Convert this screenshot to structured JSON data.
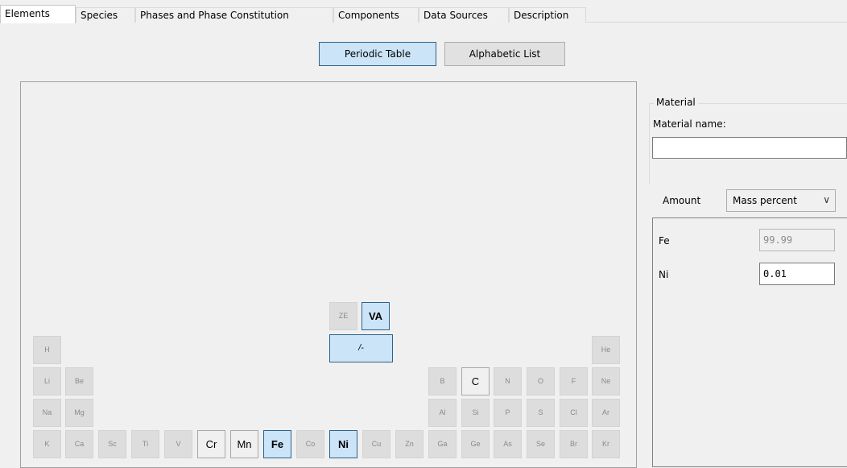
{
  "tabs": [
    {
      "label": "Elements",
      "active": true
    },
    {
      "label": "Species",
      "active": false
    },
    {
      "label": "Phases and Phase Constitution",
      "active": false
    },
    {
      "label": "Components",
      "active": false
    },
    {
      "label": "Data Sources",
      "active": false
    },
    {
      "label": "Description",
      "active": false
    }
  ],
  "view_toggle": {
    "periodic": "Periodic Table",
    "alphabetic": "Alphabetic List",
    "selected": "Periodic Table"
  },
  "special": {
    "ze": "ZE",
    "va": "VA",
    "ion": "/-"
  },
  "elements": {
    "row1": [
      "H",
      "He"
    ],
    "row2": [
      "Li",
      "Be",
      "B",
      "C",
      "N",
      "O",
      "F",
      "Ne"
    ],
    "row3": [
      "Na",
      "Mg",
      "Al",
      "Si",
      "P",
      "S",
      "Cl",
      "Ar"
    ],
    "row4": [
      "K",
      "Ca",
      "Sc",
      "Ti",
      "V",
      "Cr",
      "Mn",
      "Fe",
      "Co",
      "Ni",
      "Cu",
      "Zn",
      "Ga",
      "Ge",
      "As",
      "Se",
      "Br",
      "Kr"
    ]
  },
  "element_states": {
    "available": [
      "C",
      "Cr",
      "Mn"
    ],
    "selected": [
      "Fe",
      "Ni",
      "VA"
    ]
  },
  "material": {
    "group_label": "Material",
    "name_label": "Material name:",
    "name_value": "",
    "amount_label": "Amount",
    "amount_selected": "Mass percent",
    "composition": [
      {
        "element": "Fe",
        "value": "99.99",
        "readonly": true
      },
      {
        "element": "Ni",
        "value": "0.01",
        "readonly": false
      }
    ]
  },
  "colors": {
    "selected_fill": "#cce4f7",
    "selected_border": "#2c628b",
    "disabled_fill": "#dddddd",
    "background": "#f0f0f0"
  }
}
